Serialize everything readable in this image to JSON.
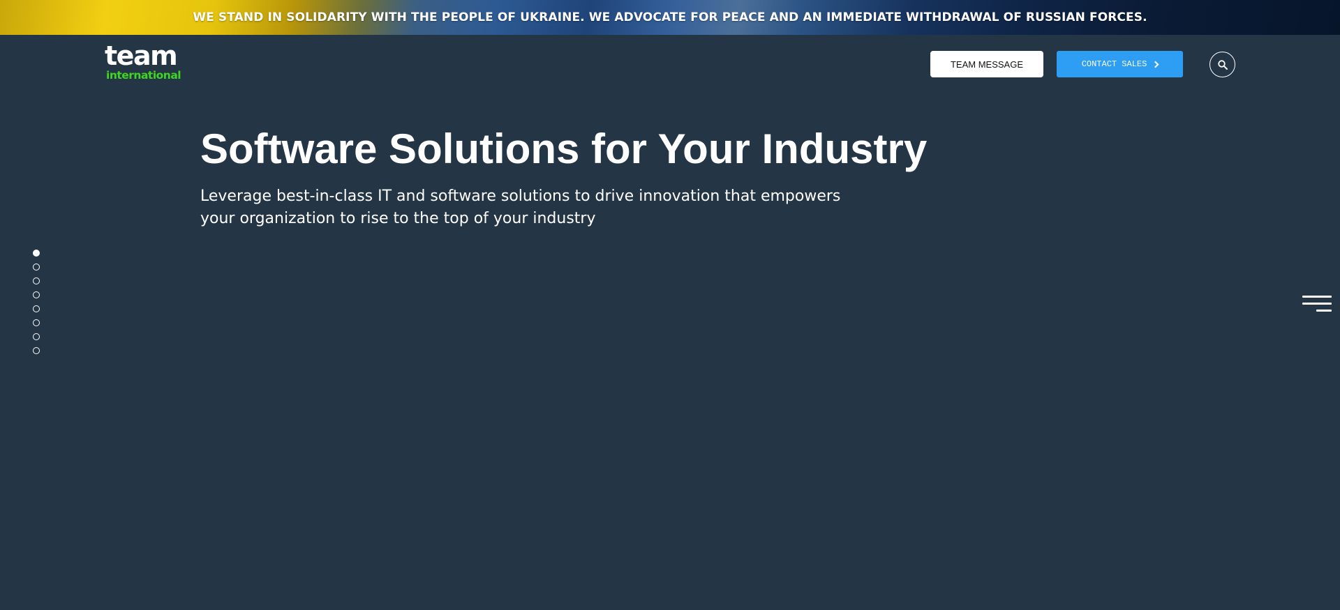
{
  "banner": {
    "text": "WE STAND IN SOLIDARITY WITH THE PEOPLE OF UKRAINE. WE ADVOCATE FOR PEACE AND AN IMMEDIATE WITHDRAWAL OF RUSSIAN FORCES."
  },
  "header": {
    "logo": {
      "line1": "team",
      "line2": "international"
    },
    "team_message_label": "TEAM MESSAGE",
    "contact_sales_label": "CONTACT SALES",
    "search_icon": "search-icon",
    "menu_icon": "hamburger-menu-icon"
  },
  "hero": {
    "title": "Software Solutions for Your Industry",
    "subtitle": "Leverage best-in-class IT and software solutions to drive innovation that empowers your organization to rise to the top of your industry"
  },
  "slide_nav": {
    "count": 8,
    "active_index": 0
  },
  "colors": {
    "background": "#243646",
    "accent_blue": "#2e9df4",
    "logo_green": "#3fd521",
    "banner_yellow": "#f2cf12",
    "banner_blue": "#2d5a93"
  }
}
